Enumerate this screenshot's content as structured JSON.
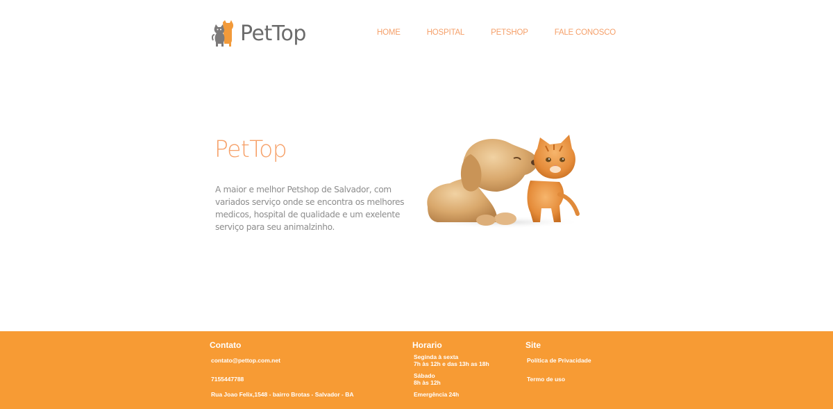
{
  "header": {
    "logo_text": "PetTop",
    "nav": [
      "HOME",
      "HOSPITAL",
      "PETSHOP",
      "FALE CONOSCO"
    ]
  },
  "hero": {
    "title": "PetTop",
    "description": "A maior e melhor Petshop de Salvador, com variados serviço onde se encontra os melhores medicos, hospital de qualidade e um exelente serviço para seu animalzinho.",
    "image": "puppy-and-kitten-photo"
  },
  "footer": {
    "contato": {
      "heading": "Contato",
      "email": "contato@pettop.com.net",
      "phone": "7155447788",
      "address": "Rua Joao Felix,1548 - bairro Brotas - Salvador - BA"
    },
    "horario": {
      "heading": "Horario",
      "weekdays_label": "Seginda à sexta",
      "weekdays_hours": "7h às 12h e das 13h as 18h",
      "saturday_label": "Sábado",
      "saturday_hours": "8h às 12h",
      "emergency": "Emergência 24h"
    },
    "site": {
      "heading": "Site",
      "privacy": "Política de Privacidade",
      "terms": "Termo de uso"
    }
  },
  "colors": {
    "accent": "#f6a068",
    "footer_bg": "#f79b34",
    "logo_text": "#6b6b6b",
    "body_text": "#8c8c8c"
  }
}
